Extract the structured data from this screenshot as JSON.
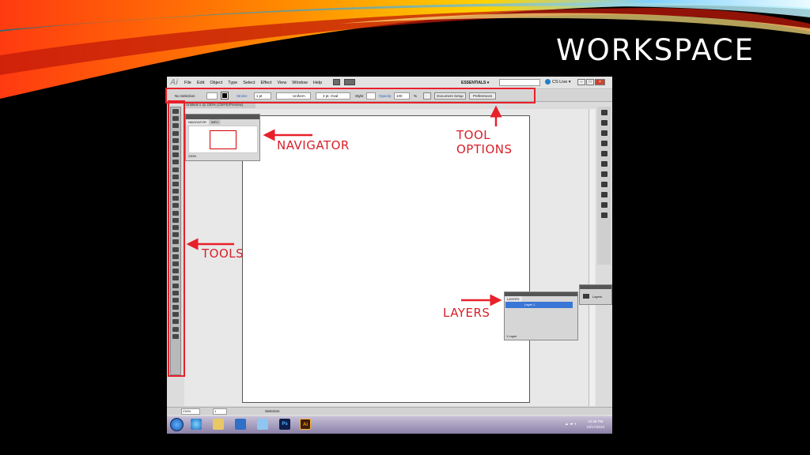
{
  "slide": {
    "title": "WORKSPACE"
  },
  "app": {
    "logo": "Ai",
    "menu": [
      "File",
      "Edit",
      "Object",
      "Type",
      "Select",
      "Effect",
      "View",
      "Window",
      "Help"
    ],
    "workspace_switcher": "ESSENTIALS ▾",
    "cs_live": "CS Live ▾"
  },
  "control_bar": {
    "selection_status": "No Selection",
    "stroke_label": "Stroke:",
    "stroke_weight": "1 pt",
    "stroke_profile": "Uniform",
    "brush": "3 pt. Oval",
    "style_label": "Style:",
    "opacity_label": "Opacity:",
    "opacity_value": "100",
    "opacity_unit": "%",
    "document_setup": "Document Setup",
    "preferences": "Preferences"
  },
  "document_tab": "Untitled-1 @ 230% (CMYK/Preview)",
  "navigator_panel": {
    "tabs": [
      "NAVIGATOR",
      "INFO"
    ],
    "zoom": "230%"
  },
  "layers_panel": {
    "tab": "LAYERS",
    "layer_name": "Layer 1",
    "footer": "1 Layer",
    "collapsed_label": "Layers"
  },
  "status_bar": {
    "zoom": "230%",
    "artboard_number": "1",
    "status": "Selection"
  },
  "taskbar": {
    "time": "12:36 PM",
    "date": "10/17/2013",
    "ps_label": "Ps",
    "ai_label": "Ai"
  },
  "annotations": {
    "navigator": "NAVIGATOR",
    "tools": "TOOLS",
    "tool_options": "TOOL\nOPTIONS",
    "layers": "LAYERS"
  },
  "colors": {
    "annotation": "#e8202a",
    "background": "#000000",
    "title": "#ffffff"
  }
}
